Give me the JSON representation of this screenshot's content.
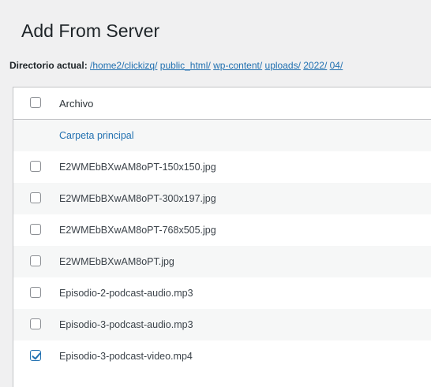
{
  "title": "Add From Server",
  "breadcrumb": {
    "label": "Directorio actual:",
    "parts": [
      "/home2/clickizq/",
      "public_html/",
      "wp-content/",
      "uploads/",
      "2022/",
      "04/"
    ]
  },
  "table": {
    "header": "Archivo",
    "parent_link": "Carpeta principal",
    "files": [
      {
        "name": "E2WMEbBXwAM8oPT-150x150.jpg",
        "checked": false
      },
      {
        "name": "E2WMEbBXwAM8oPT-300x197.jpg",
        "checked": false
      },
      {
        "name": "E2WMEbBXwAM8oPT-768x505.jpg",
        "checked": false
      },
      {
        "name": "E2WMEbBXwAM8oPT.jpg",
        "checked": false
      },
      {
        "name": "Episodio-2-podcast-audio.mp3",
        "checked": false
      },
      {
        "name": "Episodio-3-podcast-audio.mp3",
        "checked": false
      },
      {
        "name": "Episodio-3-podcast-video.mp4",
        "checked": true
      }
    ]
  },
  "colors": {
    "link": "#2271b1",
    "background": "#f0f0f1",
    "row_alt": "#f6f7f7"
  }
}
